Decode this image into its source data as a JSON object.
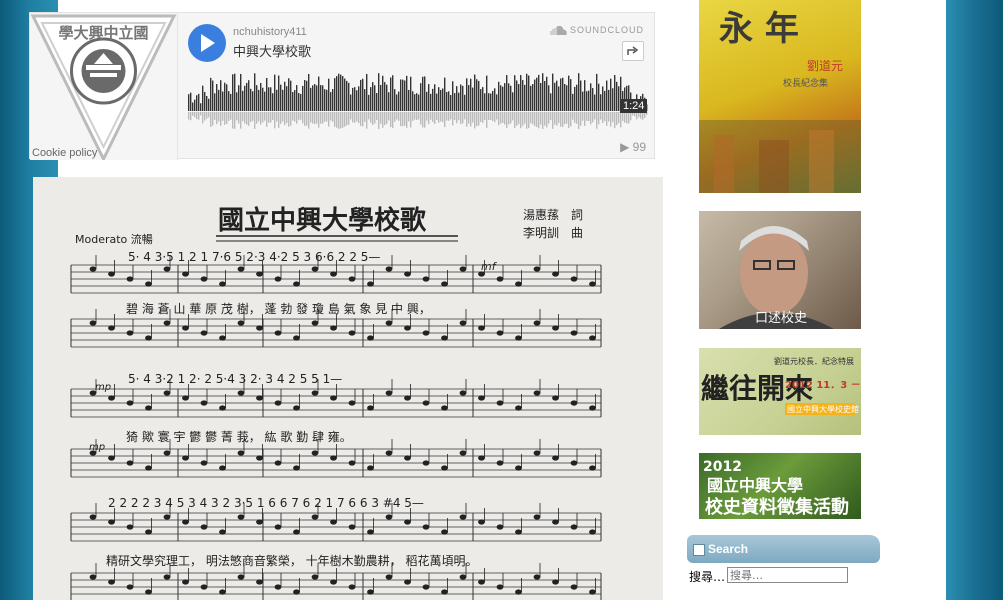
{
  "soundcloud": {
    "username": "nchuhistory411",
    "track_title": "中興大學校歌",
    "brand": "SOUNDCLOUD",
    "duration": "1:24",
    "plays": "99",
    "cookie_policy": "Cookie policy",
    "logo_text_top": "學大興中立國",
    "logo_text_ring": "NATIONAL CHUNG-HSING UNIVERSITY"
  },
  "sheet": {
    "title": "國立中興大學校歌",
    "lyricist": "湯惠蓀　詞",
    "composer": "李明訓　曲",
    "tempo": "Moderato 流暢",
    "numbered_line1": "5·  4 3·5 1   2  1 7·6  5    2·3 4·2 5 3   6·6  2 2  5—",
    "lyrics_line1": "碧 海 蒼 山 華 原 茂 樹，  蓬 勃 發  瓊 島  氣 象 見 中 興，",
    "numbered_line2": "5·  4  3·2  1    2·  2 5·4  3      2·  3  4   2      5   5   1—",
    "lyrics_line2": "猗 歟 寰 宇  鬱 鬱  菁 莪，  紘     歌     勤  肆  雍。",
    "numbered_line3": "2 2  2 2  3 4  5    3 4 3 2 3·5 1   6 6 7 6  2 1 7   6 6 3 #4  5—",
    "lyrics_line3": "精研文學究理工，  明法慜商音繁榮，  十年樹木勤農耕，  稻花萬頃明。",
    "dynamic_mf": "mf",
    "dynamic_mp": "mp"
  },
  "sidebar": {
    "banner1_title": "劉道元",
    "banner1_sub": "校長紀念集",
    "banner1_big": "永 年",
    "banner2_caption": "口述校史",
    "banner3_title": "繼往開來",
    "banner3_line1": "劉道元校長．紀念特展",
    "banner3_dates": "2012 11．3 － 12．28",
    "banner3_venue": "國立中興大學校史館",
    "banner4_year": "2012",
    "banner4_line1": "國立中興大學",
    "banner4_line2": "校史資料徵集活動"
  },
  "search": {
    "title": "Search",
    "label": "搜尋…",
    "placeholder": "搜尋…"
  },
  "colors": {
    "page_bg": "#ffffff",
    "side_gradient": "#1f7fa2",
    "play_button": "#3a7fe0",
    "search_header": "#8fb6cb"
  }
}
